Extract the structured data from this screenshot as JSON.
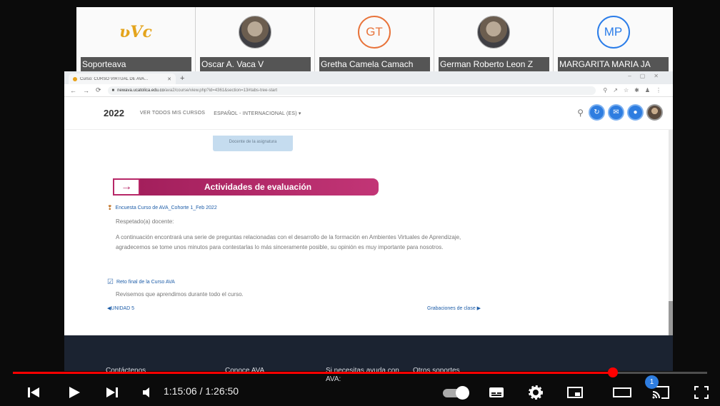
{
  "participants": [
    {
      "name": "Soporteava",
      "type": "logo",
      "logo_text": "ʋVc"
    },
    {
      "name": "Oscar A. Vaca V",
      "type": "photo"
    },
    {
      "name": "Gretha Camela Camach",
      "type": "initials",
      "initials": "GT",
      "color": "#e8733a"
    },
    {
      "name": "German Roberto Leon Z",
      "type": "photo"
    },
    {
      "name": "MARGARITA MARIA JA",
      "type": "initials",
      "initials": "MP",
      "color": "#2b7de9"
    }
  ],
  "browser": {
    "tab_title": "Curso: CURSO VIRTUAL DE AVA...",
    "url_host": "newava.ucatolica.edu.co",
    "url_path": "/ava2/course/view.php?id=4361&section=13#tabs-tree-start"
  },
  "site": {
    "year": "2022",
    "nav_courses": "VER TODOS MIS CURSOS",
    "nav_language": "ESPAÑOL - INTERNACIONAL (ES) ▾"
  },
  "content": {
    "docente_button": "Docente de la asignatura",
    "section_arrow": "→",
    "section_title": "Actividades de evaluación",
    "activity1": "Encuesta Curso de AVA_Cohorte 1_Feb 2022",
    "greeting": "Respetado(a) docente:",
    "paragraph": "A continuación encontrará una serie de preguntas relacionadas con el desarrollo de la formación en Ambientes Virtuales de Aprendizaje, agradecemos se tome unos minutos para contestarlas lo más sinceramente posible, su opinión es muy importante para nosotros.",
    "activity2": "Reto final de la Curso AVA",
    "review_text": "Revisemos que aprendimos durante todo el curso.",
    "prev_link": "◀UNIDAD 5",
    "next_link": "Grabaciones de clase ▶"
  },
  "footer": {
    "contact": "Contáctenos",
    "conoce": "Conoce AVA",
    "help": "Si necesitas ayuda con AVA:",
    "others": "Otros soportes"
  },
  "player": {
    "time_text": "1:15:06 / 1:26:50",
    "progress": 0.864,
    "badge": "1"
  }
}
